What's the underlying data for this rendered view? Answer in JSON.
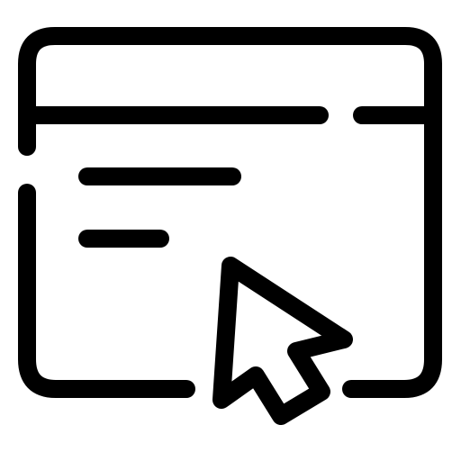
{
  "icon": {
    "name": "browser-window-cursor-icon",
    "stroke_color": "#000000",
    "background_color": "#ffffff"
  }
}
